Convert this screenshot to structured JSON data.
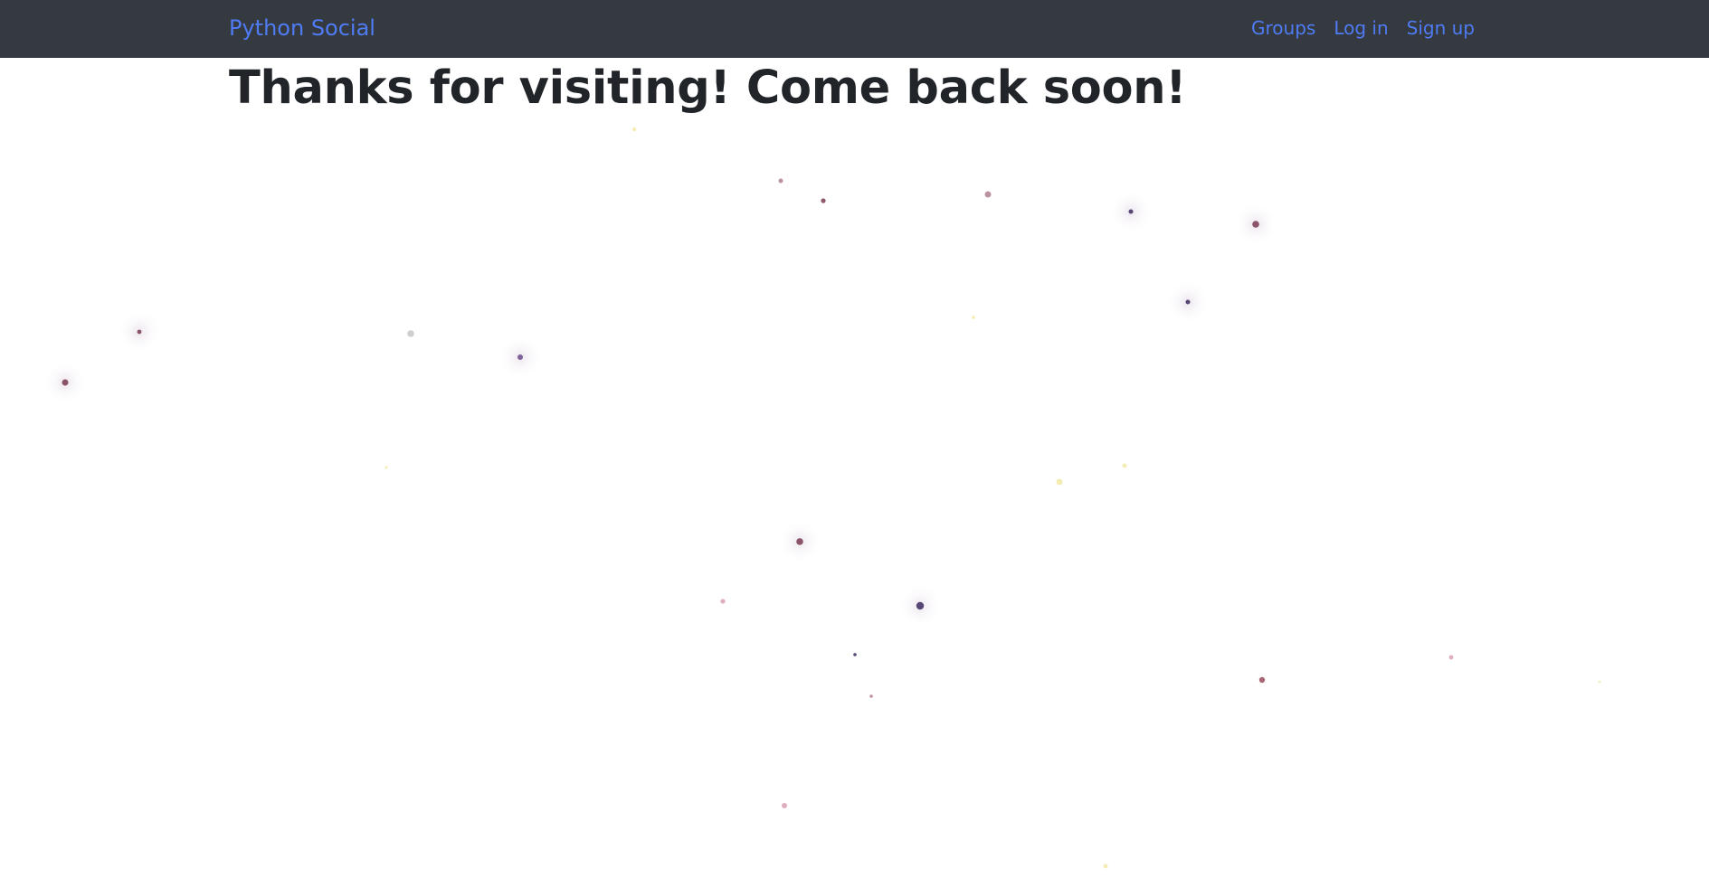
{
  "navbar": {
    "brand": "Python Social",
    "links": [
      "Groups",
      "Log in",
      "Sign up"
    ]
  },
  "main": {
    "heading": "Thanks for visiting! Come back soon!"
  },
  "colors": {
    "navbar_bg": "#343a40",
    "link": "#4f7bf4",
    "heading": "#212529"
  },
  "particles_bg": {
    "dot_colors": [
      "#7a3a52",
      "#3c2a5e",
      "#b08090",
      "#d8a0b0",
      "#f3e9a6",
      "#c7c7c7",
      "#6a4a8a",
      "#9b4a5a"
    ]
  }
}
